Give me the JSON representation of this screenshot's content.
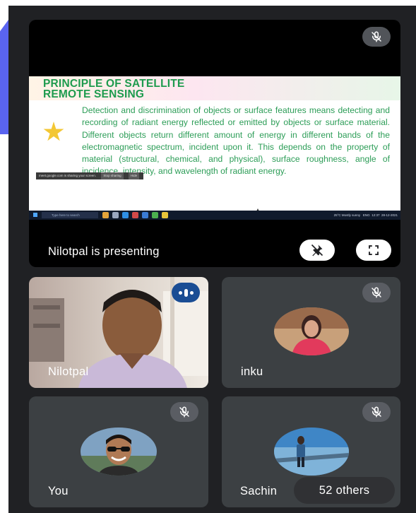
{
  "presentation": {
    "presenter_label": "Nilotpal is presenting",
    "slide": {
      "title_line1": "PRINCIPLE OF SATELLITE",
      "title_line2": "REMOTE SENSING",
      "body": "Detection and discrimination of objects or surface features means detecting and recording of radiant energy reflected or emitted by objects or surface material. Different objects return different amount of energy in different bands of the electromagnetic spectrum, incident upon it. This depends on the property of material (structural, chemical, and physical), surface roughness, angle of incidence, intensity, and wavelength of radiant energy."
    },
    "share_banner": {
      "text": "meet.google.com is sharing your screen.",
      "stop_label": "Stop sharing",
      "hide_label": "Hide"
    },
    "taskbar": {
      "search_placeholder": "Type here to search",
      "weather": "25°C  Mostly sunny",
      "lang": "ENG",
      "time": "12:37",
      "date": "28-12-2021"
    }
  },
  "participants": [
    {
      "name": "Nilotpal",
      "state": "speaking"
    },
    {
      "name": "inku",
      "state": "muted"
    },
    {
      "name": "You",
      "state": "muted"
    },
    {
      "name": "Sachin",
      "state": "muted"
    }
  ],
  "others_label": "52 others",
  "colors": {
    "background": "#202124",
    "tile": "#3c4043",
    "accent": "#5a64f0",
    "slide_green": "#2c9d57",
    "speaking_blue": "#1a4d94"
  },
  "icons": [
    "mic-off-icon",
    "pin-off-icon",
    "fullscreen-icon",
    "speaking-indicator-icon",
    "star-icon"
  ]
}
